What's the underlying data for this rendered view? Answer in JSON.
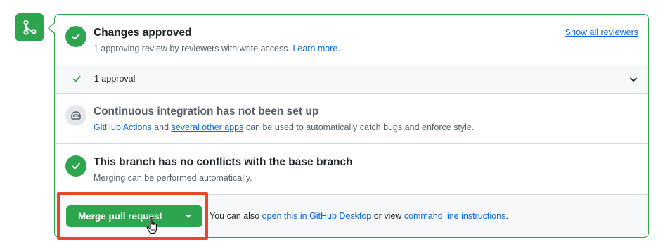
{
  "approved": {
    "title": "Changes approved",
    "subtitle_text": "1 approving review by reviewers with write access.",
    "learn_more": "Learn more.",
    "show_reviewers": "Show all reviewers"
  },
  "approval": {
    "label": "1 approval"
  },
  "ci": {
    "title": "Continuous integration has not been set up",
    "link_actions": "GitHub Actions",
    "and_text": "and",
    "link_other_apps": "several other apps",
    "rest_text": "can be used to automatically catch bugs and enforce style."
  },
  "conflicts": {
    "title": "This branch has no conflicts with the base branch",
    "subtitle": "Merging can be performed automatically."
  },
  "merge": {
    "button_label": "Merge pull request",
    "note_prefix": "You can also",
    "link_desktop": "open this in GitHub Desktop",
    "note_middle": "or view",
    "link_cli": "command line instructions",
    "note_suffix": "."
  },
  "icons": {
    "merge": "git-merge-icon",
    "check": "check-icon",
    "ci": "ci-bot-icon",
    "chevron": "chevron-down-icon",
    "caret": "triangle-down-icon",
    "cursor": "hand-pointer-icon"
  },
  "colors": {
    "green": "#2da44e",
    "link": "#0969da",
    "highlight": "#e8472a"
  }
}
